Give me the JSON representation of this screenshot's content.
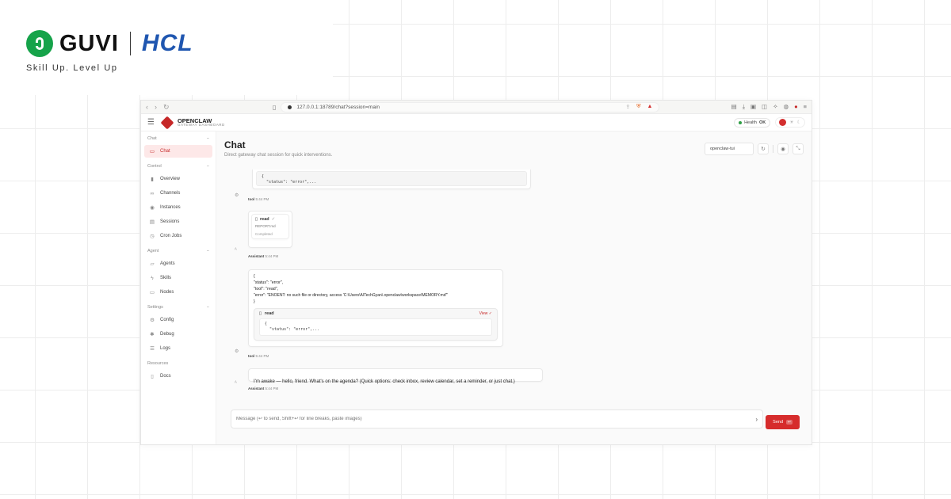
{
  "brand": {
    "guvi": "GUVI",
    "hcl": "HCL",
    "tagline": "Skill Up. Level Up"
  },
  "browser": {
    "url": "127.0.0.1:18789/chat?session=main",
    "nav_back_icon": "chevron-left-icon",
    "nav_forward_icon": "chevron-right-icon",
    "reload_icon": "reload-icon"
  },
  "app": {
    "name": "OPENCLAW",
    "subtitle": "GATEWAY DASHBOARD",
    "health_label": "Health",
    "health_status": "OK"
  },
  "sidebar": {
    "sections": [
      {
        "title": "Chat",
        "items": [
          {
            "label": "Chat",
            "icon": "chat-icon",
            "active": true
          }
        ]
      },
      {
        "title": "Control",
        "items": [
          {
            "label": "Overview",
            "icon": "bar-chart-icon"
          },
          {
            "label": "Channels",
            "icon": "link-icon"
          },
          {
            "label": "Instances",
            "icon": "radio-icon"
          },
          {
            "label": "Sessions",
            "icon": "document-icon"
          },
          {
            "label": "Cron Jobs",
            "icon": "clock-icon"
          }
        ]
      },
      {
        "title": "Agent",
        "items": [
          {
            "label": "Agents",
            "icon": "folder-icon"
          },
          {
            "label": "Skills",
            "icon": "bolt-icon"
          },
          {
            "label": "Nodes",
            "icon": "monitor-icon"
          }
        ]
      },
      {
        "title": "Settings",
        "items": [
          {
            "label": "Config",
            "icon": "gear-icon"
          },
          {
            "label": "Debug",
            "icon": "bug-icon"
          },
          {
            "label": "Logs",
            "icon": "logs-icon"
          }
        ]
      },
      {
        "title": "Resources",
        "items": [
          {
            "label": "Docs",
            "icon": "book-icon"
          }
        ]
      }
    ]
  },
  "main": {
    "title": "Chat",
    "subtitle": "Direct gateway chat session for quick interventions.",
    "session": "openclaw-tui"
  },
  "messages": {
    "m1": {
      "code": "{\n  \"status\": \"error\",...",
      "sender": "tool",
      "time": "5:44 PM"
    },
    "m2": {
      "tool": "read",
      "file": "REPORT.md",
      "status": "Completed",
      "sender": "Assistant",
      "time": "5:44 PM"
    },
    "m3": {
      "lines": [
        "{",
        "\"status\": \"error\",",
        "\"tool\": \"read\",",
        "\"error\": \"ENOENT: no such file or directory, access 'C:\\Users\\AITechGyan\\.openclaw\\workspace\\MEMORY.md'\"",
        "}"
      ],
      "tool": "read",
      "view": "View",
      "code": "{\n  \"status\": \"error\",...",
      "sender": "tool",
      "time": "5:44 PM"
    },
    "m4": {
      "text": "I'm awake — hello, friend. What's on the agenda? (Quick options: check inbox, review calendar, set a reminder, or just chat.)",
      "sender": "Assistant",
      "time": "5:44 PM"
    }
  },
  "composer": {
    "placeholder": "Message (↩ to send, Shift+↩ for line breaks, paste images)",
    "send_label": "Send",
    "send_kbd": "↩"
  }
}
